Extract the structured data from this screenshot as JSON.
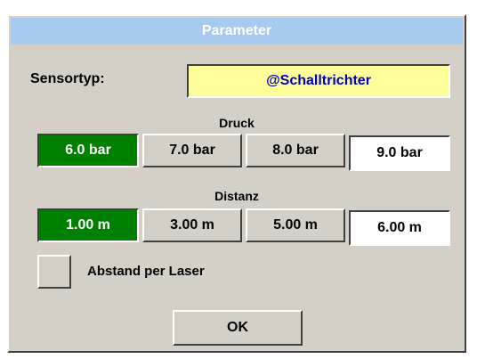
{
  "dialog": {
    "title": "Parameter",
    "sensor_label": "Sensortyp:",
    "sensor_value": "@Schalltrichter",
    "pressure": {
      "label": "Druck",
      "options": [
        "6.0 bar",
        "7.0 bar",
        "8.0 bar"
      ],
      "selected_index": 0,
      "custom_value": "9.0 bar"
    },
    "distance": {
      "label": "Distanz",
      "options": [
        "1.00 m",
        "3.00 m",
        "5.00 m"
      ],
      "selected_index": 0,
      "custom_value": "6.00 m"
    },
    "laser_checkbox_label": "Abstand per Laser",
    "ok_label": "OK"
  },
  "colors": {
    "title_bar": "#a6caf0",
    "panel": "#d4d0c8",
    "selected": "#008000",
    "sensor_field_bg": "#ffff99",
    "sensor_field_text": "#0000c0"
  }
}
